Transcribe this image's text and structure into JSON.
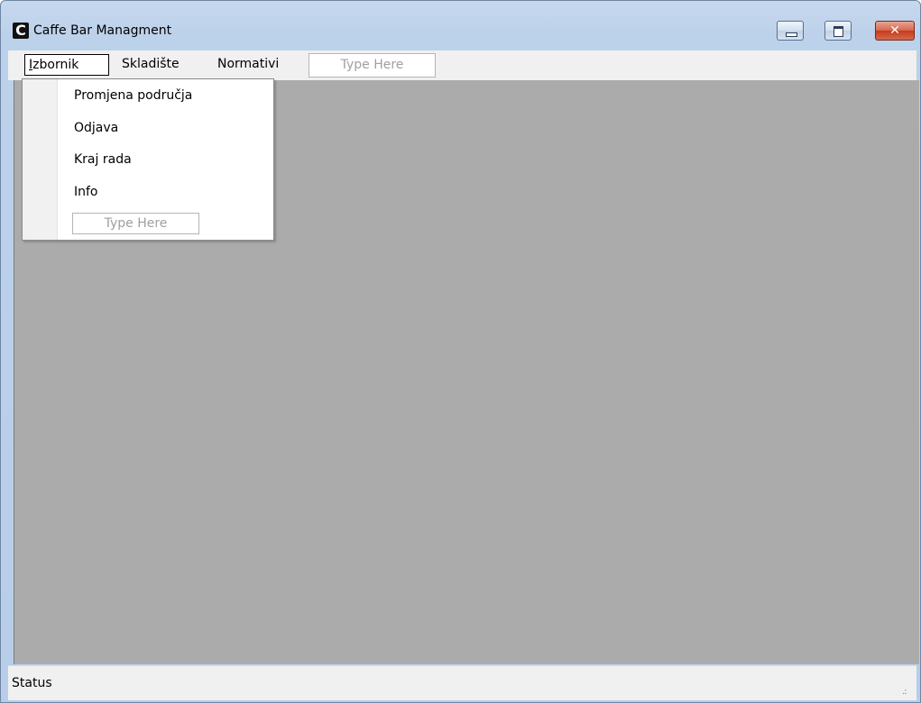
{
  "window": {
    "title": "Caffe Bar Managment",
    "app_icon_letter": "C",
    "controls": {
      "minimize": "minimize-icon",
      "maximize": "maximize-icon",
      "close": "close-icon",
      "close_glyph": "✕"
    }
  },
  "menubar": {
    "items": [
      {
        "label": "Izbornik",
        "active": true
      },
      {
        "label": "Skladište"
      },
      {
        "label": "Normativi"
      }
    ],
    "type_here": "Type Here"
  },
  "dropdown": {
    "items": [
      {
        "label": "Promjena područja"
      },
      {
        "label": "Odjava"
      },
      {
        "label": "Kraj rada"
      },
      {
        "label": "Info"
      }
    ],
    "type_here": "Type Here"
  },
  "statusbar": {
    "text": "Status",
    "grip": ".:"
  },
  "colors": {
    "client_background": "#ababab",
    "titlebar": "#bcd1ea",
    "close_button": "#c7391a"
  }
}
